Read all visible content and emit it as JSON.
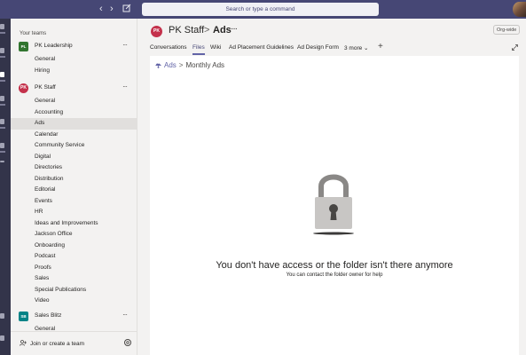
{
  "search": {
    "placeholder": "Search or type a command"
  },
  "rail": {
    "items": [
      "activity-icon",
      "chat-icon",
      "teams-icon",
      "calendar-icon",
      "calls-icon",
      "files-icon",
      "more-icon",
      "help-icon"
    ]
  },
  "panel": {
    "heading": "Your teams",
    "teams": [
      {
        "name": "PK Leadership",
        "avatar": "PL",
        "avatar_color": "#31752f",
        "channels": [
          "General",
          "Hiring"
        ]
      },
      {
        "name": "PK Staff",
        "avatar": "PK",
        "avatar_color": "#c4314b",
        "channels": [
          "General",
          "Accounting",
          "Ads",
          "Calendar",
          "Community Service",
          "Digital",
          "Directories",
          "Distribution",
          "Editorial",
          "Events",
          "HR",
          "Ideas and Improvements",
          "Jackson Office",
          "Onboarding",
          "Podcast",
          "Proofs",
          "Sales",
          "Special Publications",
          "Video"
        ]
      },
      {
        "name": "Sales Blitz",
        "avatar": "SB",
        "avatar_color": "#038387",
        "channels": [
          "General"
        ]
      }
    ],
    "active_channel": "Ads",
    "more_label": "···",
    "join_label": "Join or create a team"
  },
  "header": {
    "team_logo": "PK",
    "team": "PK Staff",
    "separator": ">",
    "channel": "Ads",
    "more": "···",
    "org_badge": "Org-wide",
    "tabs": [
      "Conversations",
      "Files",
      "Wiki",
      "Ad Placement Guidelines",
      "Ad Design Form",
      "3 more ⌄"
    ],
    "active_tab": "Files",
    "add_tab": "+"
  },
  "content": {
    "path_root": "Ads",
    "path_sep": ">",
    "path_current": "Monthly Ads",
    "message_title": "You don't have access or the folder isn't there anymore",
    "message_sub": "You can contact the folder owner for help"
  },
  "colors": {
    "titlebar": "#464775",
    "accent": "#6264a7",
    "rail": "#33344a"
  }
}
